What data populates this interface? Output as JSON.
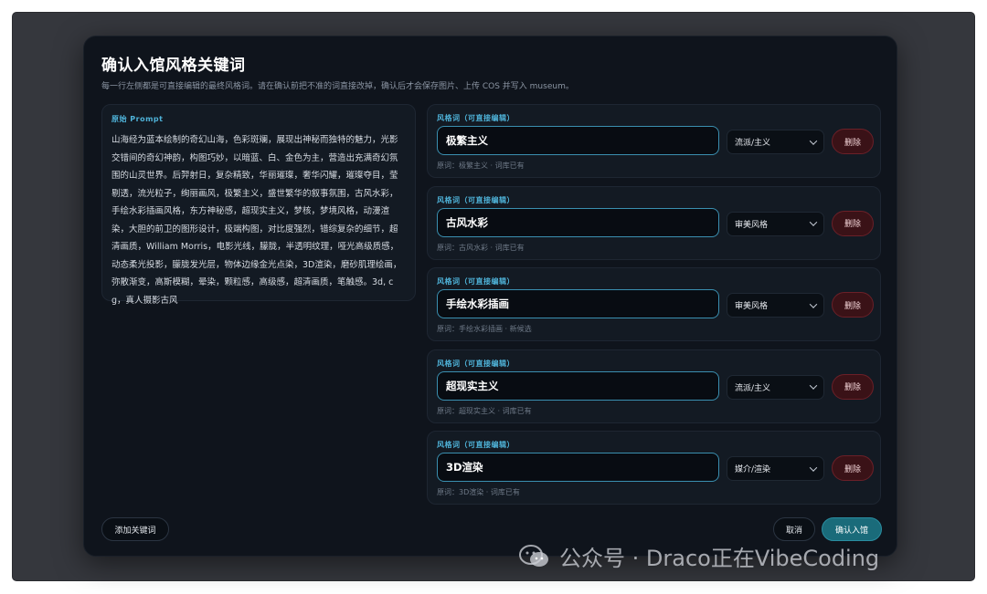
{
  "dialog": {
    "title": "确认入馆风格关键词",
    "subtitle": "每一行左侧都是可直接编辑的最终风格词。请在确认前把不准的词直接改掉，确认后才会保存图片、上传 COS 并写入 museum。"
  },
  "prompt": {
    "label": "原始 Prompt",
    "text": "山海经为蓝本绘制的奇幻山海，色彩斑斓，展现出神秘而独特的魅力，光影交错间的奇幻神韵，构图巧妙，以暗蓝、白、金色为主，营造出充满奇幻氛围的山灵世界。后羿射日，复杂精致，华丽璀璨，奢华闪耀，璀璨夺目，莹剔透，流光粒子，绚丽画风，极繁主义，盛世繁华的叙事氛围，古风水彩，手绘水彩插画风格，东方神秘感，超现实主义，梦核，梦境风格，动漫渲染，大胆的前卫的图形设计，极端构图，对比度强烈，错综复杂的细节，超清画质，William Morris，电影光线，朦胧，半透明纹理，哑光高级质感，动态柔光投影，朦胧发光层，物体边缘金光点染，3D渲染，磨砂肌理绘画，弥散渐变，高斯模糊，晕染，颗粒感，高级感，超清画质，笔触感。3d, cg，真人摄影古风"
  },
  "keywords": [
    {
      "label": "风格词（可直接编辑）",
      "value": "极繁主义",
      "category": "流派/主义",
      "delete_label": "删除",
      "source": "原词：极繁主义 · 词库已有"
    },
    {
      "label": "风格词（可直接编辑）",
      "value": "古风水彩",
      "category": "审美风格",
      "delete_label": "删除",
      "source": "原词：古风水彩 · 词库已有"
    },
    {
      "label": "风格词（可直接编辑）",
      "value": "手绘水彩插画",
      "category": "审美风格",
      "delete_label": "删除",
      "source": "原词：手绘水彩插画 · 新候选"
    },
    {
      "label": "风格词（可直接编辑）",
      "value": "超现实主义",
      "category": "流派/主义",
      "delete_label": "删除",
      "source": "原词：超现实主义 · 词库已有"
    },
    {
      "label": "风格词（可直接编辑）",
      "value": "3D渲染",
      "category": "媒介/渲染",
      "delete_label": "删除",
      "source": "原词：3D渲染 · 词库已有"
    }
  ],
  "footer": {
    "add_label": "添加关键词",
    "cancel_label": "取消",
    "confirm_label": "确认入馆"
  },
  "watermark": {
    "text": "公众号 · Draco正在VibeCoding",
    "icon": "wechat-icon"
  },
  "colors": {
    "accent": "#4fb3d9",
    "confirm": "#1a6b7a",
    "delete": "#3a1217",
    "modal_bg": "#0f141c"
  }
}
